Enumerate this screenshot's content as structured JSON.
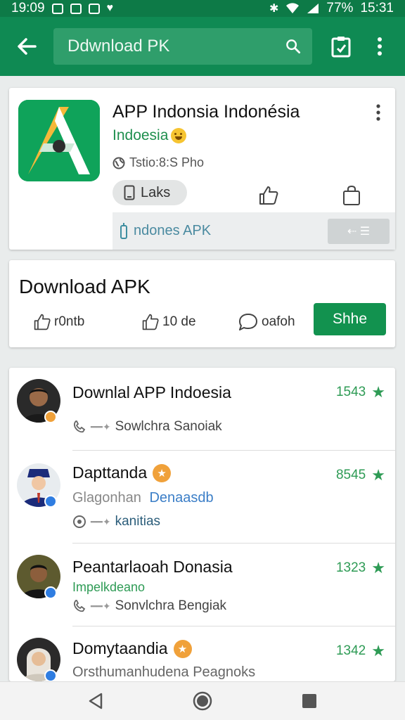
{
  "status_bar": {
    "time_left": "19:09",
    "battery": "77%",
    "time_right": "15:31"
  },
  "search": {
    "value": "Ddwnload PK"
  },
  "app_card": {
    "name": "APP Indonsia Indonésia",
    "developer": "Indoesia",
    "meta": "Tstio:8:S Pho",
    "likes_label": "Laks",
    "apk_label": "ndones APK",
    "apk_button": "⇠ ☰"
  },
  "download_card": {
    "title": "Download APK",
    "stat1": "r0ntb",
    "stat2": "10 de",
    "stat3": "oafoh",
    "share_label": "Shhe"
  },
  "reviews": [
    {
      "title": "Downlal APP Indoesia",
      "rating": "1543",
      "meta": "Sowlchra Sanoiak"
    },
    {
      "title": "Dapttanda",
      "subtitle_a": "Glagonhan",
      "subtitle_b": "Denaasdb",
      "rating": "8545",
      "meta": "kanitias"
    },
    {
      "title": "Peantarlaoah Donasia",
      "subtitle": "Impelkdeano",
      "rating": "1323",
      "meta": "Sonvlchra Bengiak"
    },
    {
      "title": "Domytaandia",
      "subtitle": "Orsthumanhudena Peagnoks",
      "rating": "1342"
    }
  ],
  "colors": {
    "primary": "#0f8a53",
    "status_bar": "#0d7a47",
    "accent_green": "#12924f",
    "rating_green": "#2e9b55",
    "badge_orange": "#f0a13a"
  }
}
